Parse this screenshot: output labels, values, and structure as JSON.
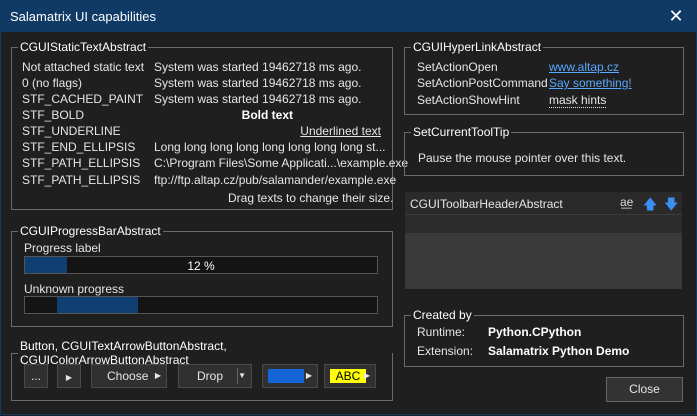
{
  "window": {
    "title": "Salamatrix UI capabilities"
  },
  "static_text": {
    "legend": "CGUIStaticTextAbstract",
    "rows": [
      {
        "label": "Not attached static text",
        "value": "System was started 19462718 ms ago."
      },
      {
        "label": "0 (no flags)",
        "value": "System was started 19462718 ms ago."
      },
      {
        "label": "STF_CACHED_PAINT",
        "value": "System was started 19462718 ms ago."
      },
      {
        "label": "STF_BOLD",
        "value": "Bold text"
      },
      {
        "label": "STF_UNDERLINE",
        "value": "Underlined text"
      },
      {
        "label": "STF_END_ELLIPSIS",
        "value": "Long long long long long long long long st..."
      },
      {
        "label": "STF_PATH_ELLIPSIS",
        "value": "C:\\Program Files\\Some Applicati...\\example.exe"
      },
      {
        "label": "STF_PATH_ELLIPSIS",
        "value": "ftp://ftp.altap.cz/pub/salamander/example.exe"
      }
    ],
    "hint": "Drag texts to change their size."
  },
  "hyperlink": {
    "legend": "CGUIHyperLinkAbstract",
    "rows": [
      {
        "label": "SetActionOpen",
        "value": "www.altap.cz"
      },
      {
        "label": "SetActionPostCommand",
        "value": "Say something!"
      },
      {
        "label": "SetActionShowHint",
        "value": "mask hints"
      }
    ]
  },
  "tooltip": {
    "legend": "SetCurrentToolTip",
    "text": "Pause the mouse pointer over this text."
  },
  "toolbar_header": {
    "title": "CGUIToolbarHeaderAbstract",
    "icon1": "text-cursor-icon",
    "icon2": "arrow-up-icon",
    "icon3": "arrow-down-icon"
  },
  "progress": {
    "legend": "CGUIProgressBarAbstract",
    "label1": "Progress label",
    "value1_text": "12 %",
    "value1": 0.12,
    "label2": "Unknown progress"
  },
  "buttons": {
    "legend": "Button, CGUITextArrowButtonAbstract, CGUIColorArrowButtonAbstract",
    "ellipsis": "...",
    "choose": "Choose",
    "drop": "Drop",
    "abc": "ABC",
    "color_blue": "#1565d8",
    "color_yellow": "#ffff00"
  },
  "created_by": {
    "legend": "Created by",
    "runtime_label": "Runtime:",
    "runtime_value": "Python.CPython",
    "extension_label": "Extension:",
    "extension_value": "Salamatrix Python Demo"
  },
  "close_button": "Close"
}
